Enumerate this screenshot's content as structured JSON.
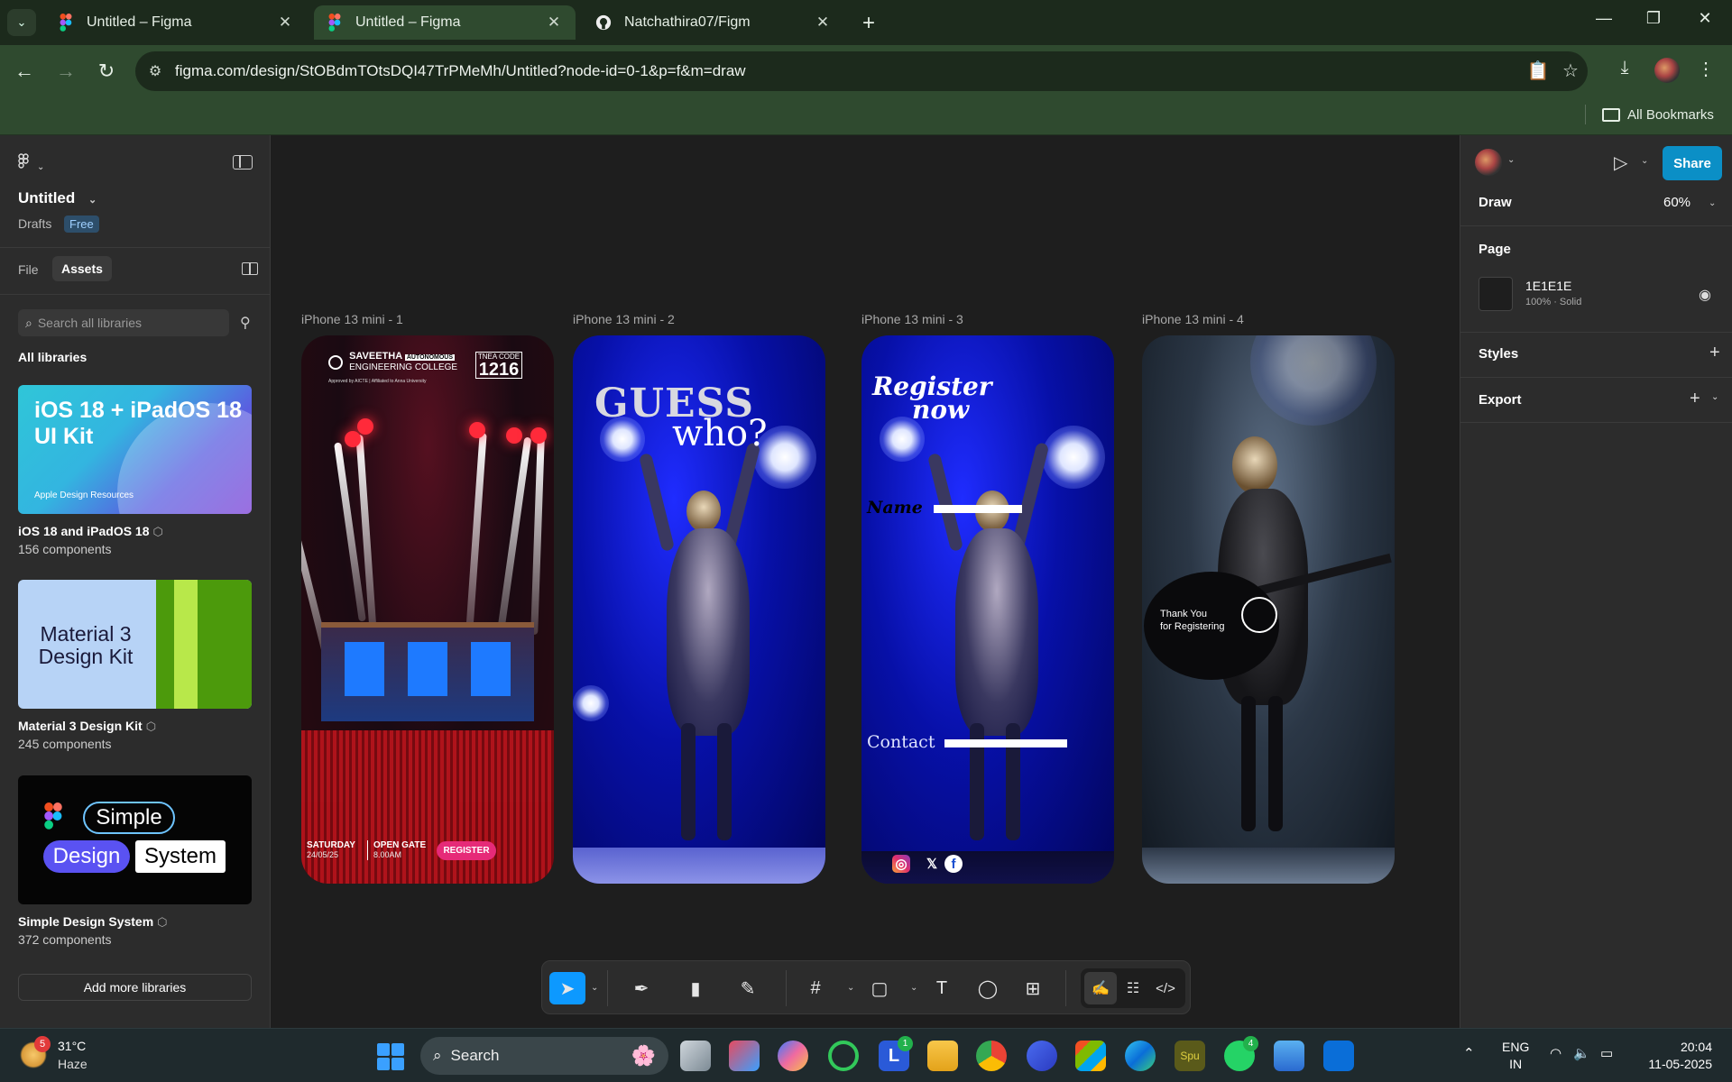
{
  "browser": {
    "tabs": [
      {
        "title": "Untitled – Figma",
        "active": false,
        "icon": "figma-icon"
      },
      {
        "title": "Untitled – Figma",
        "active": true,
        "icon": "figma-icon"
      },
      {
        "title": "Natchathira07/Figm",
        "active": false,
        "icon": "github-icon"
      }
    ],
    "url": "figma.com/design/StOBdmTOtsDQI47TrPMeMh/Untitled?node-id=0-1&p=f&m=draw",
    "all_bookmarks": "All Bookmarks",
    "accent": "#2f4a2f"
  },
  "left_panel": {
    "file_title": "Untitled",
    "drafts": "Drafts",
    "plan_badge": "Free",
    "tab_file": "File",
    "tab_assets": "Assets",
    "search_placeholder": "Search all libraries",
    "all_libraries": "All libraries",
    "libraries": [
      {
        "name": "iOS 18 and iPadOS 18",
        "count": "156 components",
        "card_title": "iOS 18 + iPadOS 18 UI Kit",
        "card_sub": "Apple Design Resources"
      },
      {
        "name": "Material 3 Design Kit",
        "count": "245 components",
        "card_title": "Material 3 Design Kit"
      },
      {
        "name": "Simple Design System",
        "count": "372 components",
        "card_words": [
          "Simple",
          "Design",
          "System"
        ]
      }
    ],
    "add_more": "Add more libraries"
  },
  "canvas": {
    "frames": [
      {
        "label": "iPhone 13 mini - 1"
      },
      {
        "label": "iPhone 13 mini - 2"
      },
      {
        "label": "iPhone 13 mini - 3"
      },
      {
        "label": "iPhone 13 mini - 4"
      }
    ],
    "frame1": {
      "college": "SAVEETHA",
      "college2": "ENGINEERING COLLEGE",
      "autonomous": "AUTONOMOUS",
      "tnea_label": "TNEA CODE",
      "tnea_code": "1216",
      "approved": "Approved by AICTE | Affiliated to Anna University",
      "day": "SATURDAY",
      "date": "24/05/25",
      "gate_label": "OPEN GATE",
      "gate_time": "8.00AM",
      "register": "REGISTER"
    },
    "frame2": {
      "guess": "GUESS",
      "who": "who?"
    },
    "frame3": {
      "register": "Register",
      "now": "now",
      "name_label": "Name",
      "contact_label": "Contact"
    },
    "frame4": {
      "thank1": "Thank You",
      "thank2": "for Registering"
    }
  },
  "right_panel": {
    "share": "Share",
    "mode": "Draw",
    "zoom": "60%",
    "page_heading": "Page",
    "page_color_hex": "1E1E1E",
    "page_color_sub": "100% · Solid",
    "styles": "Styles",
    "export": "Export"
  },
  "taskbar": {
    "weather_badge": "5",
    "temp": "31°C",
    "condition": "Haze",
    "search": "Search",
    "badge_l": "1",
    "badge_whatsapp": "4",
    "lang1": "ENG",
    "lang2": "IN",
    "time": "20:04",
    "date": "11-05-2025"
  }
}
